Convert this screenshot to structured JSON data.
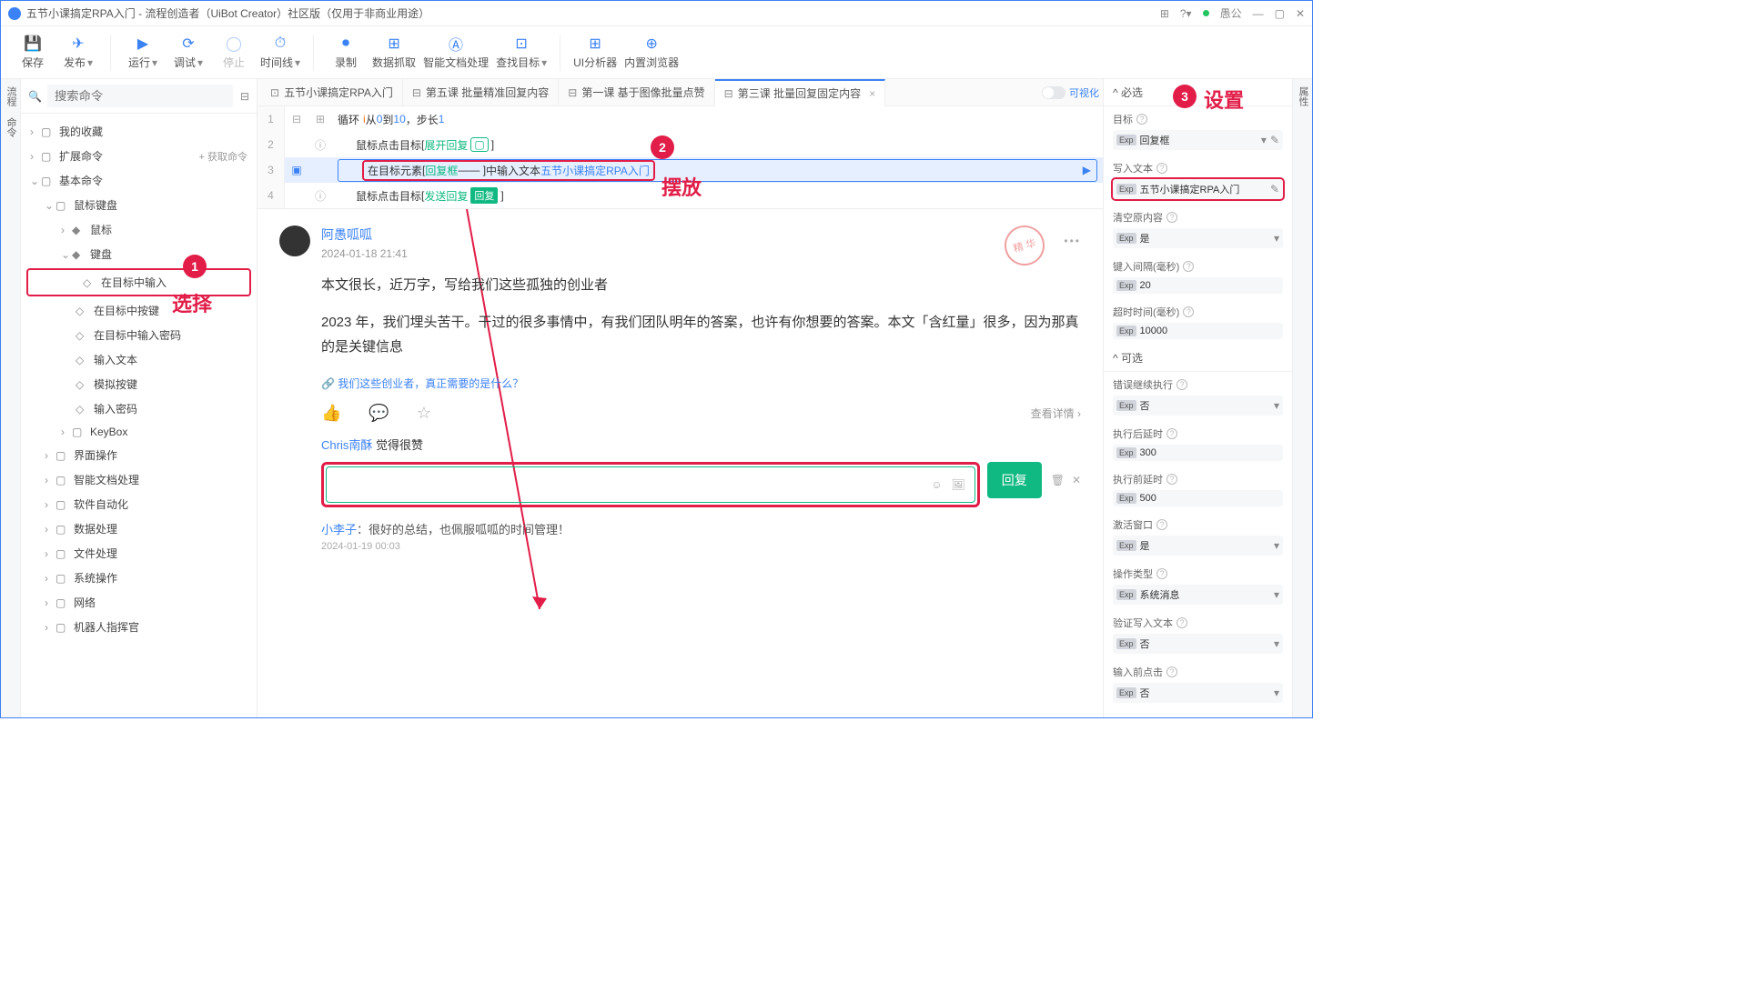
{
  "window": {
    "title": "五节小课搞定RPA入门 - 流程创造者（UiBot Creator）社区版（仅用于非商业用途）",
    "user": "愚公"
  },
  "toolbar": {
    "save": "保存",
    "publish": "发布",
    "run": "运行",
    "debug": "调试",
    "stop": "停止",
    "timeline": "时间线",
    "record": "录制",
    "dataCapture": "数据抓取",
    "smartDoc": "智能文档处理",
    "findTarget": "查找目标",
    "uiAnalyzer": "UI分析器",
    "browser": "内置浏览器"
  },
  "search": {
    "placeholder": "搜索命令"
  },
  "tree": {
    "fav": "我的收藏",
    "ext": "扩展命令",
    "getCmd": "+ 获取命令",
    "basic": "基本命令",
    "mk": "鼠标键盘",
    "mouse": "鼠标",
    "keyboard": "键盘",
    "k1": "在目标中输入",
    "k2": "在目标中按键",
    "k3": "在目标中输入密码",
    "k4": "输入文本",
    "k5": "模拟按键",
    "k6": "输入密码",
    "keybox": "KeyBox",
    "ui": "界面操作",
    "smart": "智能文档处理",
    "soft": "软件自动化",
    "data": "数据处理",
    "file": "文件处理",
    "sys": "系统操作",
    "net": "网络",
    "robot": "机器人指挥官"
  },
  "tabs": {
    "t1": "五节小课搞定RPA入门",
    "t2": "第五课 批量精准回复内容",
    "t3": "第一课 基于图像批量点赞",
    "t4": "第三课 批量回复固定内容",
    "visual": "可视化"
  },
  "code": {
    "loop_a": "循环",
    "loop_b": " 从 ",
    "loop_c": " 到 ",
    "loop_d": "，步长 ",
    "i": "i",
    "v0": "0",
    "v10": "10",
    "v1": "1",
    "l2a": "鼠标点击目标",
    "l2b": "展开回复",
    "l2c": "▢",
    "l3a": "在目标元素",
    "l3b": "回复框",
    "l3c": "中输入文本",
    "l3d": "五节小课搞定RPA入门",
    "l4a": "鼠标点击目标",
    "l4b": "发送回复",
    "l4c": "回复"
  },
  "anno": {
    "a1": "选择",
    "a2": "摆放",
    "a3": "设置"
  },
  "post": {
    "name": "阿愚呱呱",
    "time": "2024-01-18 21:41",
    "p1": "本文很长，近万字，写给我们这些孤独的创业者",
    "p2": "2023 年，我们埋头苦干。干过的很多事情中，有我们团队明年的答案，也许有你想要的答案。本文「含红量」很多，因为那真的是关键信息",
    "link": "🔗 我们这些创业者，真正需要的是什么？",
    "detail": "查看详情 ›",
    "stamp": "精 华",
    "like_name": "Chris南酥",
    "like_txt": " 觉得很赞",
    "replyBtn": "回复",
    "c_name": "小李子",
    "c_txt": "：很好的总结，也佩服呱呱的时间管理！",
    "c_time": "2024-01-19 00:03"
  },
  "props": {
    "required": "^ 必选",
    "optional": "^ 可选",
    "target_l": "目标",
    "target_v": "回复框",
    "text_l": "写入文本",
    "text_v": "五节小课搞定RPA入门",
    "clear_l": "清空原内容",
    "clear_v": "是",
    "interval_l": "键入间隔(毫秒)",
    "interval_v": "20",
    "timeout_l": "超时时间(毫秒)",
    "timeout_v": "10000",
    "err_l": "错误继续执行",
    "err_v": "否",
    "after_l": "执行后延时",
    "after_v": "300",
    "before_l": "执行前延时",
    "before_v": "500",
    "active_l": "激活窗口",
    "active_v": "是",
    "type_l": "操作类型",
    "type_v": "系统消息",
    "verify_l": "验证写入文本",
    "verify_v": "否",
    "click_l": "输入前点击",
    "click_v": "否"
  },
  "vtab": {
    "left": "流程 命令",
    "right": "属性"
  }
}
